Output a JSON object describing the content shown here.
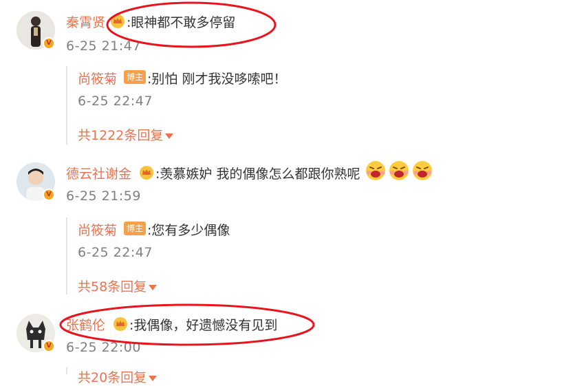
{
  "colors": {
    "accent": "#eb7350",
    "text": "#333333",
    "muted": "#808080",
    "host_badge": "#f7a04b",
    "annotation": "#e8141d"
  },
  "comments": [
    {
      "author": "秦霄贤",
      "text": ":眼神都不敢多停留",
      "time": "6-25 21:47",
      "reply": {
        "author": "尚筱菊",
        "badge": "博主",
        "text": ":别怕 刚才我没哆嗦吧！",
        "time": "6-25 22:47"
      },
      "more": "共1222条回复"
    },
    {
      "author": "德云社谢金",
      "text": ":羡慕嫉妒 我的偶像怎么都跟你熟呢",
      "time": "6-25 21:59",
      "reply": {
        "author": "尚筱菊",
        "badge": "博主",
        "text": ":您有多少偶像",
        "time": "6-25 22:47"
      },
      "more": "共58条回复"
    },
    {
      "author": "张鹤伦",
      "text": ":我偶像，好遗憾没有见到",
      "time": "6-25 22:00",
      "more": "共20条回复"
    }
  ],
  "icons": {
    "verified": "verified-badge-icon",
    "crown": "crown-icon",
    "emoji": "laughing-crying-emoji-icon",
    "caret": "caret-down-icon"
  }
}
